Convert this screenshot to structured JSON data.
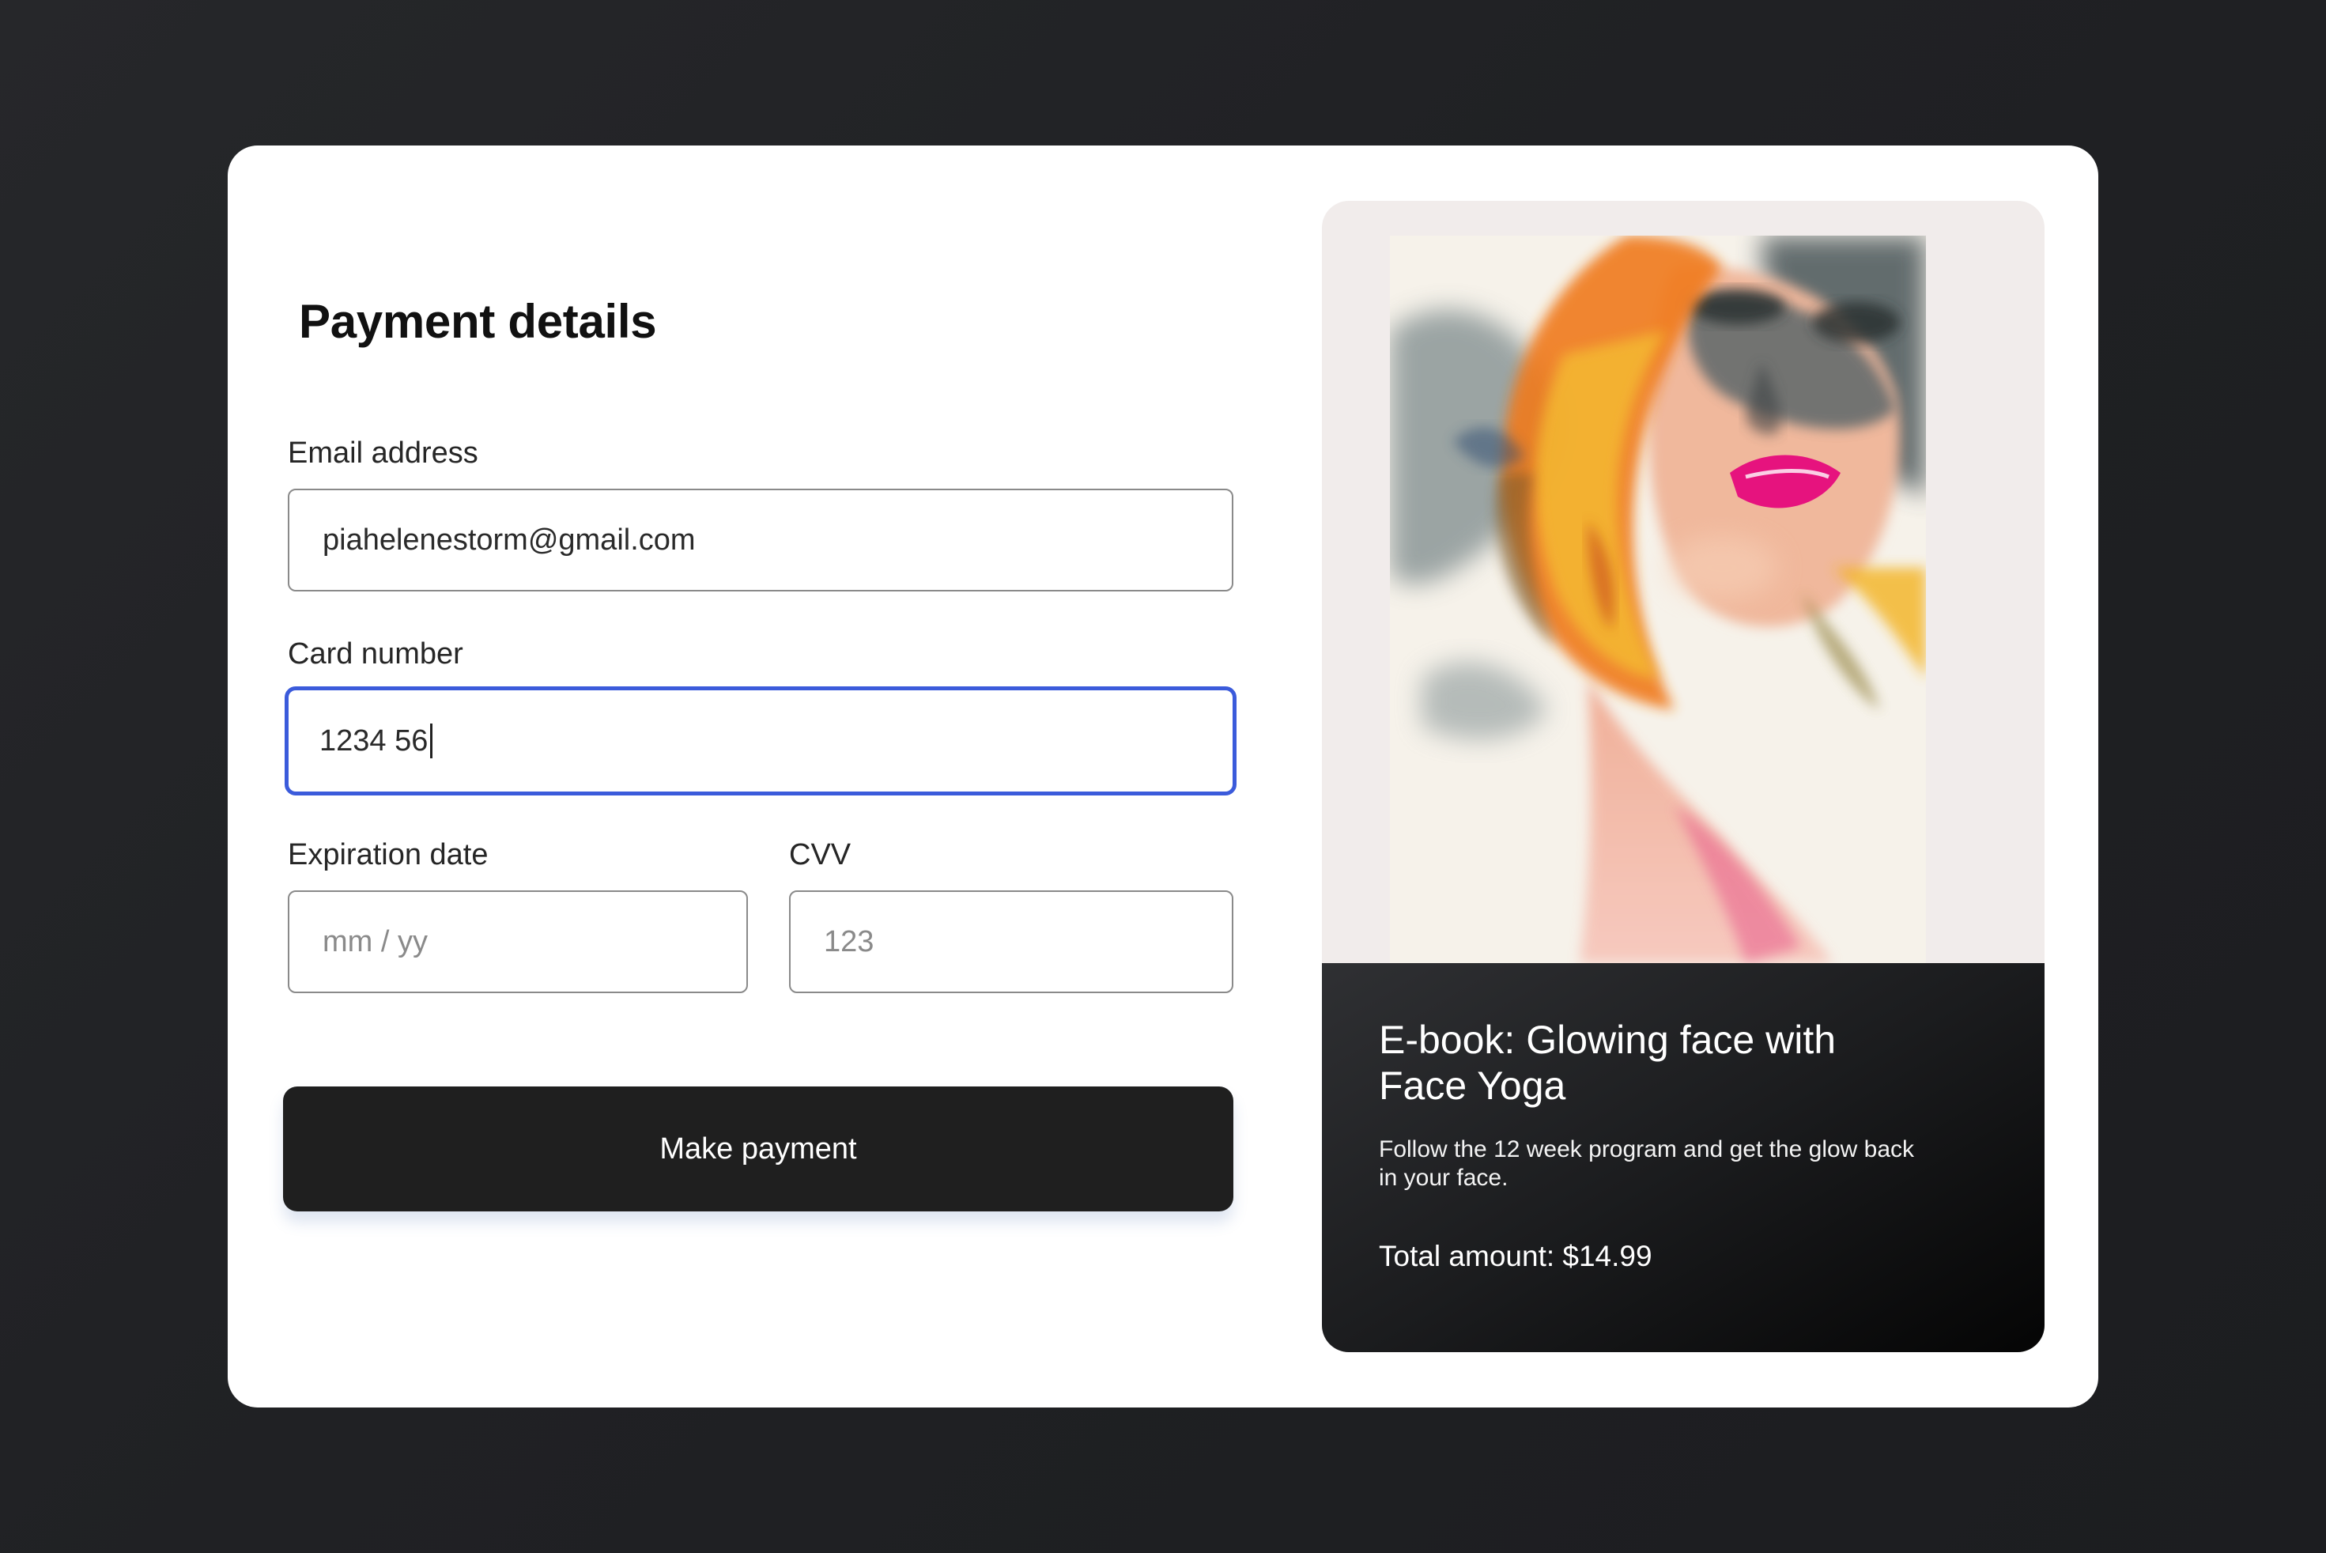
{
  "form": {
    "title": "Payment details",
    "email": {
      "label": "Email address",
      "value": "piahelenestorm@gmail.com"
    },
    "card_number": {
      "label": "Card number",
      "value": "1234 56"
    },
    "expiration": {
      "label": "Expiration date",
      "placeholder": "mm / yy"
    },
    "cvv": {
      "label": "CVV",
      "placeholder": "123"
    },
    "submit_label": "Make payment"
  },
  "product": {
    "title": "E-book: Glowing face with Face Yoga",
    "description": "Follow the 12 week program and get the glow back in your face.",
    "total": "Total amount: $14.99",
    "image_subject": "watercolor-portrait-woman"
  },
  "colors": {
    "focus_accent": "#3b5bdb",
    "button_bg": "#1f1f1f",
    "page_bg": "#232427",
    "product_panel_bg": "#f1eceb"
  }
}
